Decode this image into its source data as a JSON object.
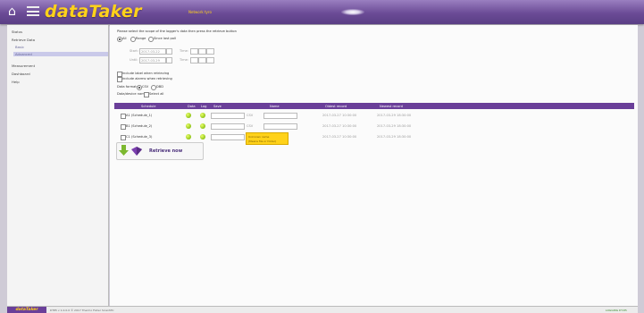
{
  "header": {
    "logo_text": "dataTaker",
    "network_name": "Network tyro"
  },
  "sidebar": {
    "items": [
      {
        "label": "Status"
      },
      {
        "label": "Retrieve Data"
      },
      {
        "label": "Basic"
      },
      {
        "label": "Advanced"
      },
      {
        "label": "Measurement"
      },
      {
        "label": "Dashboard"
      },
      {
        "label": "Help"
      }
    ]
  },
  "main": {
    "instruction": "Please select the scope of the logger's data then press the retrieve button",
    "scope_options": [
      "All",
      "Range",
      "Since last poll"
    ],
    "start_label": "Start:",
    "start_date": "2017-03-22",
    "end_label": "Until:",
    "end_date": "2017-03-29",
    "time_label": "Time:",
    "include_label_alarms": "Include label when retrieving",
    "include_headers": "Include alarms when retrieving",
    "data_format_label": "Data format:",
    "format_options": [
      "CSV",
      "DBD"
    ],
    "data_name_label": "Data/device name:",
    "select_all_label": "Select all",
    "columns": [
      "Schedule",
      "Data",
      "Log",
      "Save",
      "Name",
      "Oldest record",
      "Newest record"
    ],
    "rows": [
      {
        "schedule": "A1 (Schedule_1)",
        "ext": "CSV",
        "oldest": "2017-03-27 10:30:00",
        "newest": "2017-03-29 18:30:00"
      },
      {
        "schedule": "B1 (Schedule_2)",
        "ext": "CSV",
        "oldest": "2017-03-27 10:30:00",
        "newest": "2017-03-29 18:30:00"
      },
      {
        "schedule": "C1 (Schedule_3)",
        "ext": "",
        "oldest": "2017-03-27 10:30:00",
        "newest": "2017-03-29 18:30:00"
      }
    ],
    "tooltip_line1": "Unknown name",
    "tooltip_line2": "(Means file or folder)",
    "retrieve_label": "Retrieve now"
  },
  "footer": {
    "logo_text": "dataTaker",
    "status_text": "DT85 v 1.0.0.0 © 2017 Thermo Fisher Scientific",
    "right_text": "LOGGING  DT-85"
  },
  "colors": {
    "header_purple": "#6b4b96",
    "accent_yellow": "#ffd21a",
    "table_header": "#6a3f99"
  }
}
